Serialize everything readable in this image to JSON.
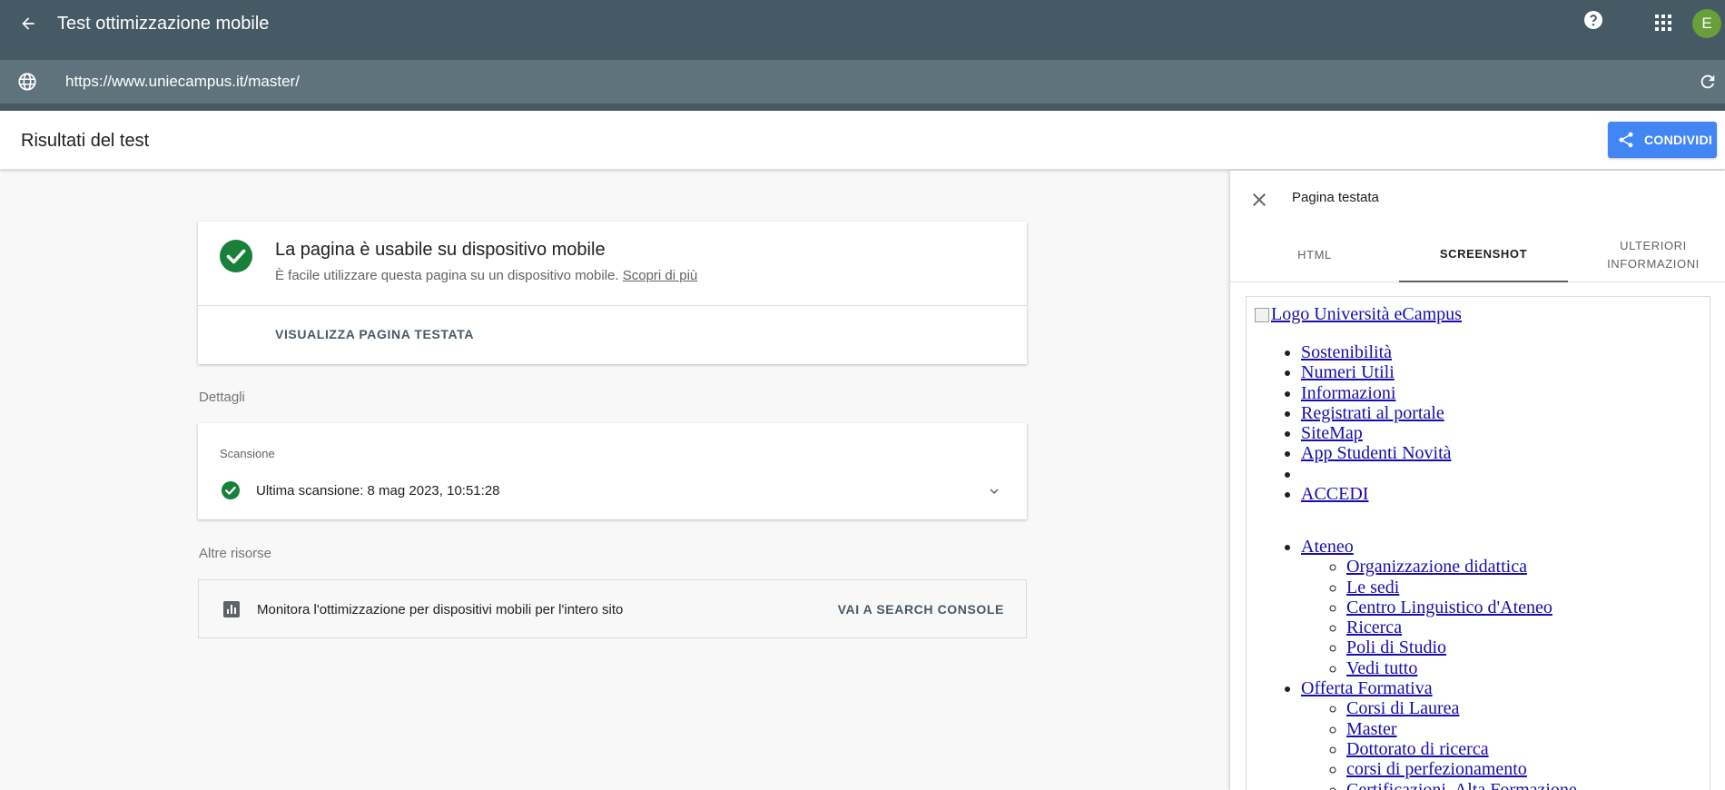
{
  "appbar": {
    "title": "Test ottimizzazione mobile",
    "avatar_letter": "E",
    "url": "https://www.uniecampus.it/master/",
    "icons": [
      "back-arrow-icon",
      "help-icon",
      "apps-grid-icon",
      "globe-icon",
      "reload-icon"
    ]
  },
  "results": {
    "title": "Risultati del test",
    "share_label": "CONDIVIDI"
  },
  "mobile_card": {
    "title": "La pagina è usabile su dispositivo mobile",
    "description": "È facile utilizzare questa pagina su un dispositivo mobile.",
    "learn_more": "Scopri di più",
    "view_page": "VISUALIZZA PAGINA TESTATA"
  },
  "details": {
    "label": "Dettagli",
    "scan_title": "Scansione",
    "scan_text": "Ultima scansione: 8 mag 2023, 10:51:28"
  },
  "resources": {
    "label": "Altre risorse",
    "text": "Monitora l'ottimizzazione per dispositivi mobili per l'intero sito",
    "link": "VAI A SEARCH CONSOLE"
  },
  "panel": {
    "title": "Pagina testata",
    "tabs": [
      {
        "label": "HTML"
      },
      {
        "label": "SCREENSHOT"
      },
      {
        "label": "ULTERIORI INFORMAZIONI"
      }
    ],
    "screenshot": {
      "logo_alt": "Logo Università eCampus",
      "top_links": [
        "Sostenibilità",
        "Numeri Utili",
        "Informazioni",
        "Registrati al portale",
        "SiteMap",
        "App Studenti Novità",
        "",
        "ACCEDI"
      ],
      "ateneo": "Ateneo",
      "ateneo_items": [
        "Organizzazione didattica",
        "Le sedi",
        "Centro Linguistico d'Ateneo",
        "Ricerca",
        "Poli di Studio",
        "Vedi tutto"
      ],
      "offerta": "Offerta Formativa",
      "offerta_items": [
        "Corsi di Laurea",
        "Master",
        "Dottorato di ricerca",
        "corsi di perfezionamento",
        "Certificazioni, Alta Formazione"
      ]
    }
  },
  "colors": {
    "appbar": "#455a64",
    "urlbar": "#5f737d",
    "accent_blue": "#4285f4",
    "success_green": "#188038",
    "avatar": "#689f38"
  }
}
